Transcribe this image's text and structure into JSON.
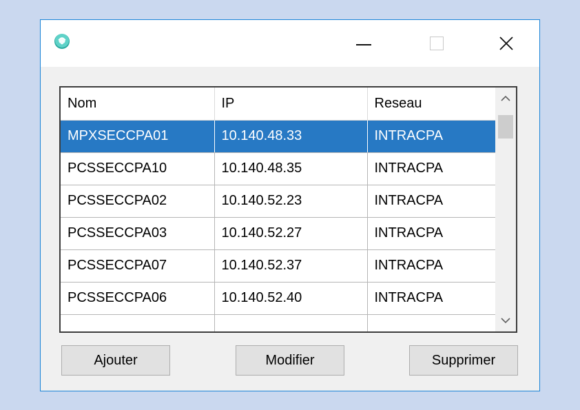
{
  "window": {
    "title": "",
    "icon": "network-globe-icon",
    "controls": {
      "minimize": "minimize-icon",
      "maximize": "maximize-icon",
      "close": "close-icon"
    },
    "accent_border": "#1883d7"
  },
  "list": {
    "columns": [
      "Nom",
      "IP",
      "Reseau"
    ],
    "rows": [
      {
        "nom": "MPXSECCPA01",
        "ip": "10.140.48.33",
        "reseau": "INTRACPA",
        "selected": true
      },
      {
        "nom": "PCSSECCPA10",
        "ip": "10.140.48.35",
        "reseau": "INTRACPA"
      },
      {
        "nom": "PCSSECCPA02",
        "ip": "10.140.52.23",
        "reseau": "INTRACPA"
      },
      {
        "nom": "PCSSECCPA03",
        "ip": "10.140.52.27",
        "reseau": "INTRACPA"
      },
      {
        "nom": "PCSSECCPA07",
        "ip": "10.140.52.37",
        "reseau": "INTRACPA"
      },
      {
        "nom": "PCSSECCPA06",
        "ip": "10.140.52.40",
        "reseau": "INTRACPA"
      }
    ],
    "selection_color": "#2779c4"
  },
  "buttons": {
    "add": "Ajouter",
    "edit": "Modifier",
    "delete": "Supprimer"
  }
}
